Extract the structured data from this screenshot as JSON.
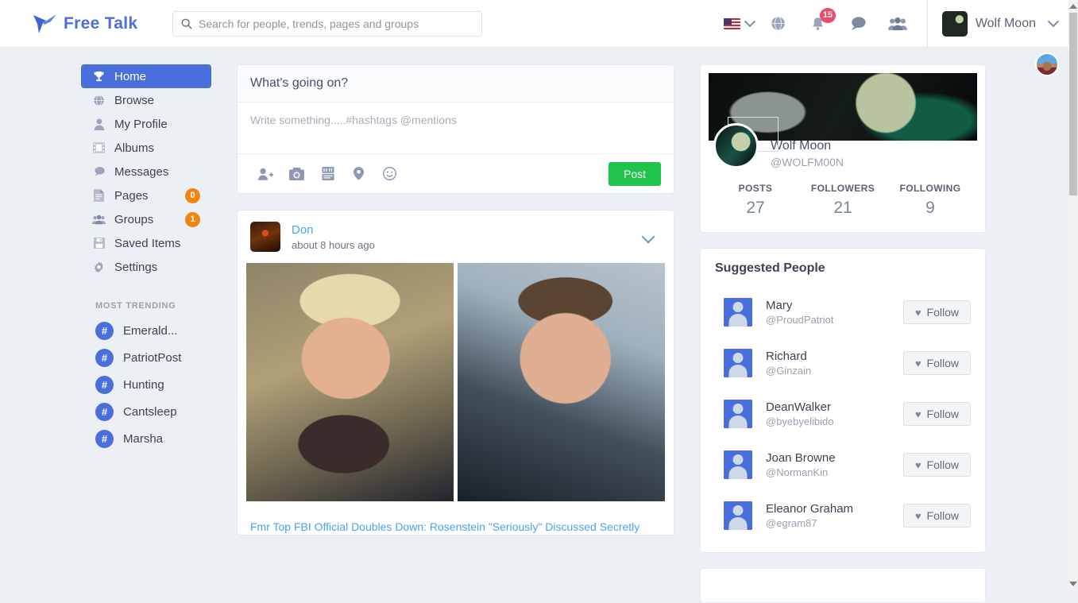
{
  "app": {
    "brand": "Free Talk"
  },
  "search": {
    "placeholder": "Search for people, trends, pages and groups",
    "value": ""
  },
  "topbar": {
    "notifications_count": "15",
    "user_name": "Wolf Moon",
    "icons": [
      "flag-us-icon",
      "globe-icon",
      "bell-icon",
      "chat-bubble-icon",
      "people-icon"
    ]
  },
  "sidebar": {
    "items": [
      {
        "label": "Home",
        "icon": "trophy-icon",
        "active": true,
        "badge": null
      },
      {
        "label": "Browse",
        "icon": "globe-icon",
        "active": false,
        "badge": null
      },
      {
        "label": "My Profile",
        "icon": "user-icon",
        "active": false,
        "badge": null
      },
      {
        "label": "Albums",
        "icon": "film-icon",
        "active": false,
        "badge": null
      },
      {
        "label": "Messages",
        "icon": "chat-icon",
        "active": false,
        "badge": null
      },
      {
        "label": "Pages",
        "icon": "file-icon",
        "active": false,
        "badge": "0"
      },
      {
        "label": "Groups",
        "icon": "people-icon",
        "active": false,
        "badge": "1"
      },
      {
        "label": "Saved Items",
        "icon": "floppy-icon",
        "active": false,
        "badge": null
      },
      {
        "label": "Settings",
        "icon": "gear-icon",
        "active": false,
        "badge": null
      }
    ],
    "trending_title": "MOST TRENDING",
    "trending": [
      {
        "label": "Emerald..."
      },
      {
        "label": "PatriotPost"
      },
      {
        "label": "Hunting"
      },
      {
        "label": "Cantsleep"
      },
      {
        "label": "Marsha"
      }
    ]
  },
  "composer": {
    "title": "What's going on?",
    "placeholder": "Write something.....#hashtags @mentions",
    "value": "",
    "tools": [
      "tag-friend-icon",
      "camera-icon",
      "youtube-icon",
      "location-icon",
      "emoji-icon"
    ],
    "post_label": "Post"
  },
  "feed": {
    "posts": [
      {
        "author": "Don",
        "time": "about 8 hours ago",
        "link_text": "Fmr Top FBI Official Doubles Down: Rosenstein \"Seriously\" Discussed Secretly"
      }
    ]
  },
  "profile": {
    "name": "Wolf Moon",
    "handle": "@WOLFM00N",
    "stats": [
      {
        "label": "POSTS",
        "value": "27"
      },
      {
        "label": "FOLLOWERS",
        "value": "21"
      },
      {
        "label": "FOLLOWING",
        "value": "9"
      }
    ]
  },
  "suggested": {
    "title": "Suggested People",
    "follow_label": "Follow",
    "people": [
      {
        "name": "Mary",
        "handle": "@ProudPatriot"
      },
      {
        "name": "Richard",
        "handle": "@Ginzain"
      },
      {
        "name": "DeanWalker",
        "handle": "@byebyelibido"
      },
      {
        "name": "Joan Browne",
        "handle": "@NormanKin"
      },
      {
        "name": "Eleanor Graham",
        "handle": "@egram87"
      }
    ]
  },
  "colors": {
    "accent_blue": "#4a6fdc",
    "link_blue": "#4aa3ef",
    "post_green": "#20c44a",
    "badge_orange": "#f2850f",
    "notif_pink": "#ef4a6b",
    "page_bg": "#eceff3"
  }
}
